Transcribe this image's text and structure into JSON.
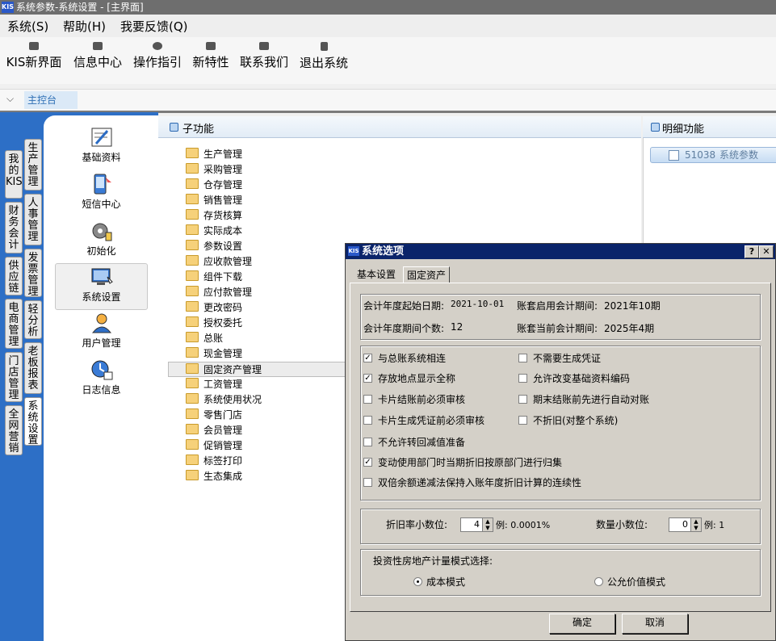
{
  "window": {
    "logo": "KIS",
    "title": "系统参数-系统设置 - [主界面]"
  },
  "menubar": [
    "系统(S)",
    "帮助(H)",
    "我要反馈(Q)"
  ],
  "toolbar": [
    {
      "label": "KIS新界面",
      "icon": "window-icon"
    },
    {
      "label": "信息中心",
      "icon": "mail-icon"
    },
    {
      "label": "操作指引",
      "icon": "compass-icon"
    },
    {
      "label": "新特性",
      "icon": "star-box-icon"
    },
    {
      "label": "联系我们",
      "icon": "chat-icon"
    },
    {
      "label": "退出系统",
      "icon": "exit-icon"
    }
  ],
  "tabs": {
    "current": "主控台"
  },
  "left_tabs": [
    "我的KIS",
    "财务会计",
    "供应链",
    "电商管理",
    "门店管理",
    "全网营销"
  ],
  "module_tabs": [
    "生产管理",
    "人事管理",
    "发票管理",
    "轻分析",
    "老板报表",
    "系统设置"
  ],
  "functions": [
    {
      "label": "基础资料",
      "icon": "basic-data-icon"
    },
    {
      "label": "短信中心",
      "icon": "sms-icon"
    },
    {
      "label": "初始化",
      "icon": "init-gear-icon"
    },
    {
      "label": "系统设置",
      "icon": "system-settings-icon"
    },
    {
      "label": "用户管理",
      "icon": "user-icon"
    },
    {
      "label": "日志信息",
      "icon": "log-clock-icon"
    }
  ],
  "subfunc": {
    "header": "子功能",
    "items": [
      "生产管理",
      "采购管理",
      "仓存管理",
      "销售管理",
      "存货核算",
      "实际成本",
      "参数设置",
      "应收款管理",
      "组件下载",
      "应付款管理",
      "更改密码",
      "授权委托",
      "总账",
      "现金管理",
      "固定资产管理",
      "工资管理",
      "系统使用状况",
      "零售门店",
      "会员管理",
      "促销管理",
      "标签打印",
      "生态集成"
    ],
    "selected": "固定资产管理"
  },
  "detail": {
    "header": "明细功能",
    "item_code": "51038",
    "item_label": "系统参数"
  },
  "dialog": {
    "logo": "KIS",
    "title": "系统选项",
    "help_btn": "?",
    "close_btn": "✕",
    "tabs": [
      "基本设置",
      "固定资产"
    ],
    "info": {
      "start_date_label": "会计年度起始日期:",
      "start_date": "2021-10-01",
      "start_period_label": "账套启用会计期间:",
      "start_period": "2021年10期",
      "period_count_label": "会计年度期间个数:",
      "period_count": "12",
      "current_period_label": "账套当前会计期间:",
      "current_period": "2025年4期"
    },
    "options": [
      {
        "label": "与总账系统相连",
        "checked": true
      },
      {
        "label": "不需要生成凭证",
        "checked": false
      },
      {
        "label": "存放地点显示全称",
        "checked": true
      },
      {
        "label": "允许改变基础资料编码",
        "checked": false
      },
      {
        "label": "卡片结账前必须审核",
        "checked": false
      },
      {
        "label": "期末结账前先进行自动对账",
        "checked": false
      },
      {
        "label": "卡片生成凭证前必须审核",
        "checked": false
      },
      {
        "label": "不折旧(对整个系统)",
        "checked": false
      },
      {
        "label": "不允许转回减值准备",
        "checked": false
      },
      {
        "label": "变动使用部门时当期折旧按原部门进行归集",
        "checked": true
      },
      {
        "label": "双倍余额递减法保持入账年度折旧计算的连续性",
        "checked": false
      }
    ],
    "decimals": {
      "rate_label": "折旧率小数位:",
      "rate_value": "4",
      "rate_example": "例: 0.0001%",
      "qty_label": "数量小数位:",
      "qty_value": "0",
      "qty_example": "例:  1"
    },
    "mode": {
      "label": "投资性房地产计量模式选择:",
      "options": [
        "成本模式",
        "公允价值模式"
      ],
      "selected": "成本模式"
    },
    "ok": "确定",
    "cancel": "取消"
  }
}
